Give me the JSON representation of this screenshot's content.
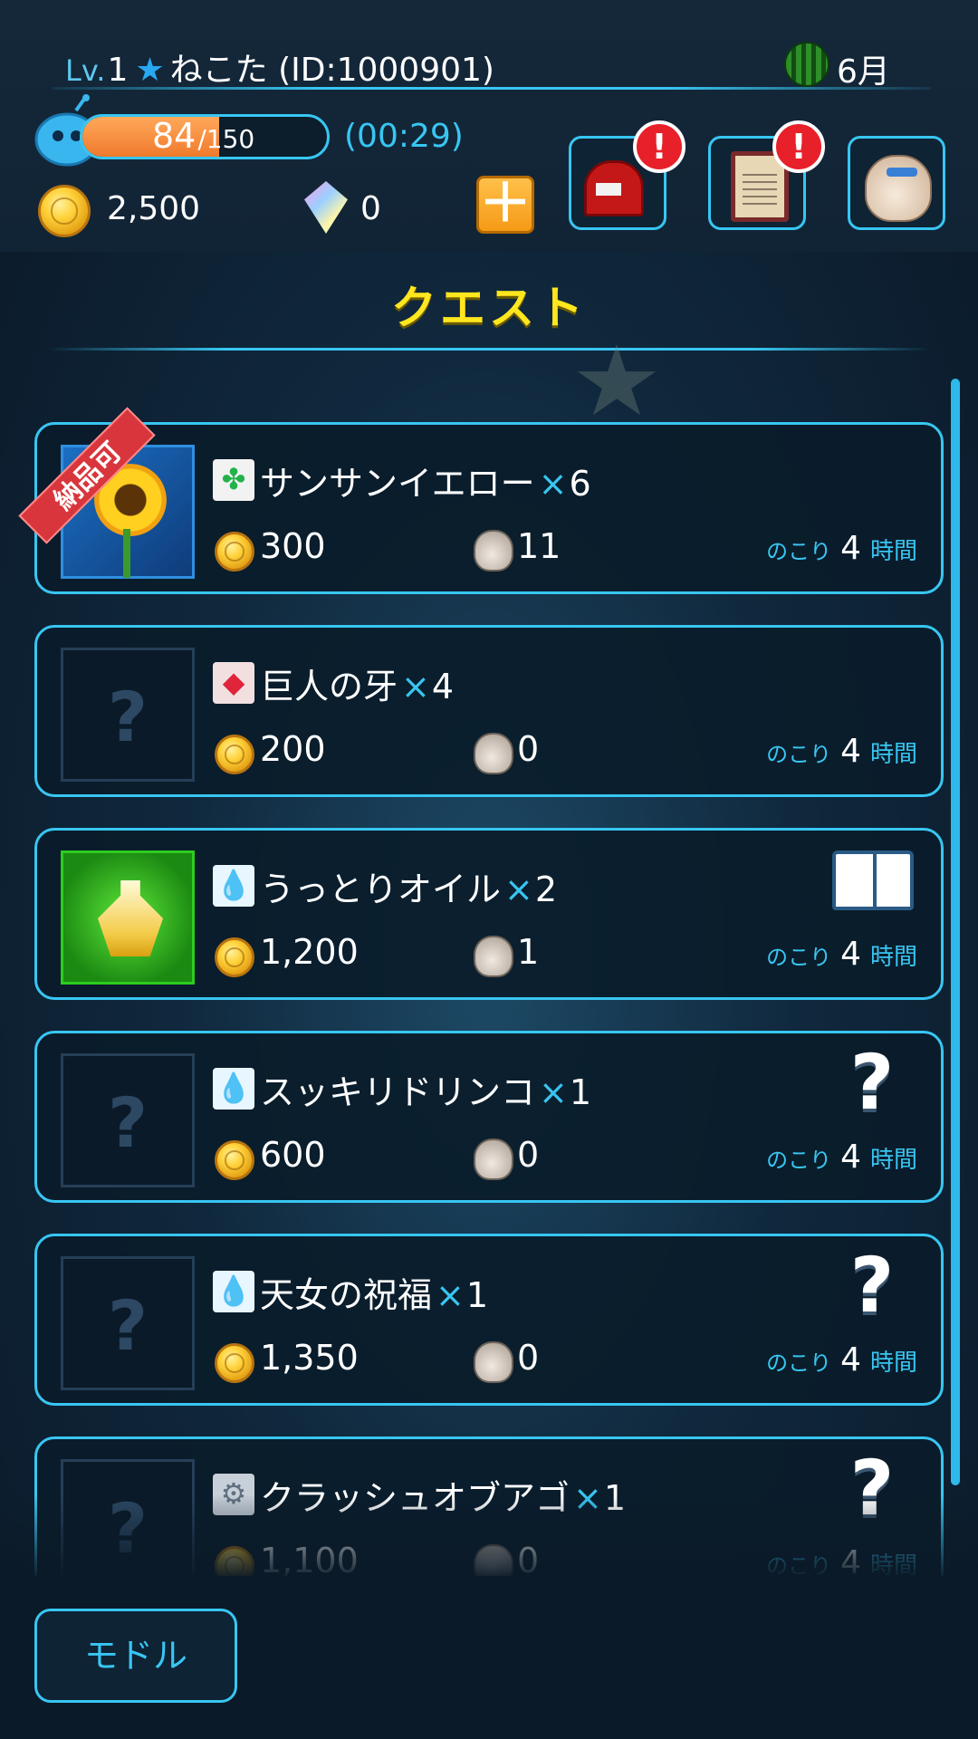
{
  "player": {
    "level_label": "Lv.",
    "level": "1",
    "star": "★",
    "name": "ねこた (ID:1000901)",
    "month": "6月",
    "month_icon": "watermelon-icon"
  },
  "stamina": {
    "current": "84",
    "max": "/150",
    "fill_fraction": 0.56,
    "timer": "(00:29)"
  },
  "currency": {
    "gold": "2,500",
    "gems": "0",
    "plus_label": "＋"
  },
  "header_buttons": [
    {
      "name": "mailbox",
      "icon": "mailbox-icon",
      "badge": "!"
    },
    {
      "name": "quest-board",
      "icon": "quest-board-icon",
      "badge": "!"
    },
    {
      "name": "bag",
      "icon": "bag-icon"
    }
  ],
  "title": "クエスト",
  "quests": [
    {
      "thumb": "sunflower",
      "ribbon": "納品可",
      "type_icon": "clover",
      "name": "サンサンイエロー",
      "x": "×",
      "count": "6",
      "gold": "300",
      "pouch": "11",
      "remaining_label": "のこり",
      "remaining_num": "4",
      "remaining_unit": "時間",
      "status": ""
    },
    {
      "thumb": "empty",
      "type_icon": "gem",
      "name": "巨人の牙",
      "x": "×",
      "count": "4",
      "gold": "200",
      "pouch": "0",
      "remaining_label": "のこり",
      "remaining_num": "4",
      "remaining_unit": "時間",
      "status": ""
    },
    {
      "thumb": "oil",
      "type_icon": "water",
      "name": "うっとりオイル",
      "x": "×",
      "count": "2",
      "gold": "1,200",
      "pouch": "1",
      "remaining_label": "のこり",
      "remaining_num": "4",
      "remaining_unit": "時間",
      "status": "book"
    },
    {
      "thumb": "empty",
      "type_icon": "water",
      "name": "スッキリドリンコ",
      "x": "×",
      "count": "1",
      "gold": "600",
      "pouch": "0",
      "remaining_label": "のこり",
      "remaining_num": "4",
      "remaining_unit": "時間",
      "status": "?"
    },
    {
      "thumb": "empty",
      "type_icon": "water",
      "name": "天女の祝福",
      "x": "×",
      "count": "1",
      "gold": "1,350",
      "pouch": "0",
      "remaining_label": "のこり",
      "remaining_num": "4",
      "remaining_unit": "時間",
      "status": "?"
    },
    {
      "thumb": "empty",
      "type_icon": "gear",
      "name": "クラッシュオブアゴ",
      "x": "×",
      "count": "1",
      "gold": "1,100",
      "pouch": "0",
      "remaining_label": "のこり",
      "remaining_num": "4",
      "remaining_unit": "時間",
      "status": "?"
    }
  ],
  "empty_thumb_mark": "?",
  "type_glyphs": {
    "clover": "✤",
    "gem": "◆",
    "water": "💧",
    "gear": "⚙"
  },
  "back_button": "モドル",
  "colors": {
    "accent": "#38c6f2",
    "title": "#ffe61e",
    "ribbon": "#d8363c",
    "badge": "#e8202a"
  }
}
